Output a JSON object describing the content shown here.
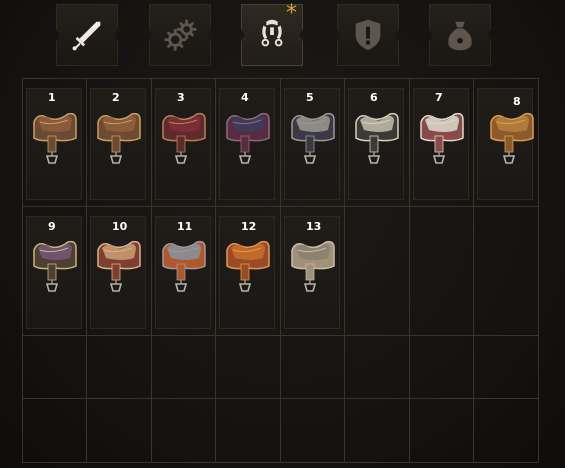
{
  "tabs": [
    {
      "id": "weapons",
      "icon": "sword-icon",
      "active": false
    },
    {
      "id": "crafting",
      "icon": "gears-icon",
      "active": false
    },
    {
      "id": "horse-gear",
      "icon": "horse-equipment-icon",
      "active": true,
      "starred": true
    },
    {
      "id": "quest",
      "icon": "exclamation-shield-icon",
      "active": false
    },
    {
      "id": "junk",
      "icon": "sack-icon",
      "active": false
    }
  ],
  "star_glyph": "*",
  "inventory": {
    "items": [
      {
        "num": "1",
        "palette": {
          "seat": "#8a5a3a",
          "flap": "#6b4a33",
          "trim": "#c8a060"
        }
      },
      {
        "num": "2",
        "palette": {
          "seat": "#8c5d3a",
          "flap": "#6e4a30",
          "trim": "#caa05c"
        }
      },
      {
        "num": "3",
        "palette": {
          "seat": "#7a2e36",
          "flap": "#5e2a2c",
          "trim": "#b48456"
        }
      },
      {
        "num": "4",
        "palette": {
          "seat": "#3e3a5a",
          "flap": "#5a2a3e",
          "trim": "#8e6a7e"
        }
      },
      {
        "num": "5",
        "palette": {
          "seat": "#8e8a86",
          "flap": "#3a3a44",
          "trim": "#a09890"
        }
      },
      {
        "num": "6",
        "palette": {
          "seat": "#b0aa98",
          "flap": "#3c3a36",
          "trim": "#d8d0bc"
        }
      },
      {
        "num": "7",
        "palette": {
          "seat": "#cfc7b8",
          "flap": "#8a4a4a",
          "trim": "#e0d8c8"
        }
      },
      {
        "num": "8",
        "palette": {
          "seat": "#b07a3a",
          "flap": "#8c5a2a",
          "trim": "#d8a050"
        }
      },
      {
        "num": "9",
        "palette": {
          "seat": "#6e5470",
          "flap": "#4e4030",
          "trim": "#c8b47a"
        }
      },
      {
        "num": "10",
        "palette": {
          "seat": "#c0906a",
          "flap": "#7e3e30",
          "trim": "#d8b48a"
        }
      },
      {
        "num": "11",
        "palette": {
          "seat": "#8a8a90",
          "flap": "#b0582a",
          "trim": "#9c9aa0"
        }
      },
      {
        "num": "12",
        "palette": {
          "seat": "#c06a2a",
          "flap": "#9a4a26",
          "trim": "#e09a4a"
        }
      },
      {
        "num": "13",
        "palette": {
          "seat": "#8c8272",
          "flap": "#a09278",
          "trim": "#c8bca4"
        }
      }
    ]
  }
}
